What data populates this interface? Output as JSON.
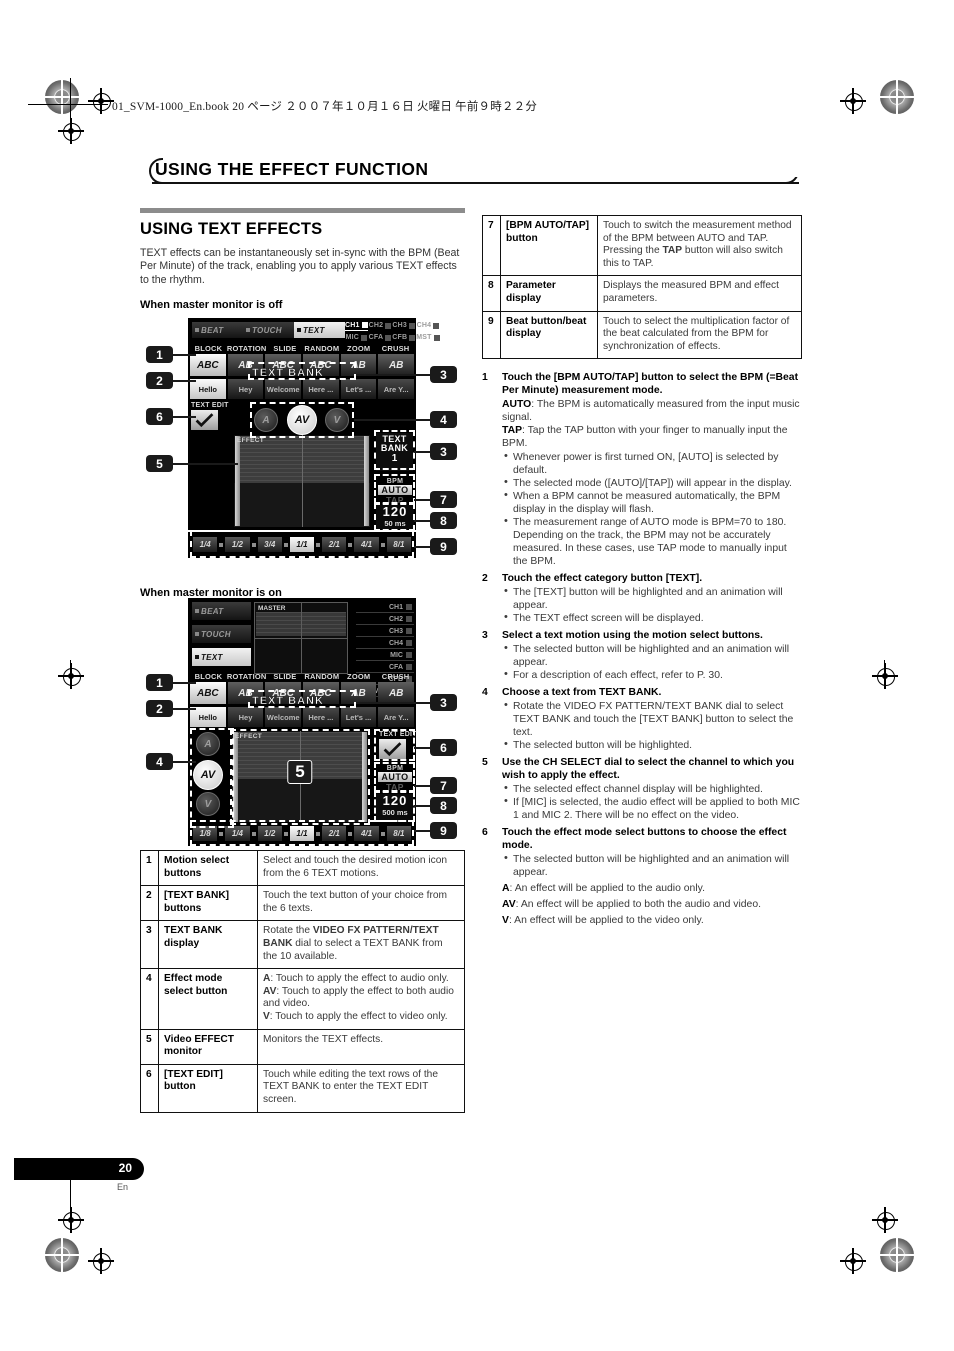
{
  "header": {
    "file_line": "01_SVM-1000_En.book  20 ページ  ２００７年１０月１６日  火曜日  午前９時２２分",
    "running_head": "USING THE EFFECT FUNCTION"
  },
  "left": {
    "section_title": "USING TEXT EFFECTS",
    "intro": "TEXT effects can be instantaneously set in-sync with the BPM (Beat Per Minute) of the track, enabling you to apply various TEXT effects to the rhythm.",
    "sub1": "When master monitor is off",
    "sub2": "When master monitor is on"
  },
  "device": {
    "fx_categories": [
      {
        "label": "BEAT",
        "active": false
      },
      {
        "label": "TOUCH",
        "active": false
      },
      {
        "label": "TEXT",
        "active": true
      }
    ],
    "channels_row1": [
      {
        "label": "CH1",
        "active": true
      },
      {
        "label": "CH2",
        "active": false
      },
      {
        "label": "CH3",
        "active": false
      },
      {
        "label": "CH4",
        "active": false
      }
    ],
    "channels_row2": [
      {
        "label": "MIC",
        "active": false
      },
      {
        "label": "CFA",
        "active": false
      },
      {
        "label": "CFB",
        "active": false
      },
      {
        "label": "MST",
        "active": false
      }
    ],
    "channels_column": [
      {
        "label": "CH1",
        "active": false
      },
      {
        "label": "CH2",
        "active": false
      },
      {
        "label": "CH3",
        "active": false
      },
      {
        "label": "CH4",
        "active": false
      },
      {
        "label": "MIC",
        "active": false
      },
      {
        "label": "CFA",
        "active": false
      },
      {
        "label": "CFB",
        "active": false
      },
      {
        "label": "MASTER",
        "active": false
      }
    ],
    "motion_labels": [
      "BLOCK",
      "ROTATION",
      "SLIDE",
      "RANDOM",
      "ZOOM",
      "CRUSH"
    ],
    "motion_glyphs": [
      "ABC",
      "AB",
      "ABC",
      "ABC",
      "AB",
      "AB"
    ],
    "text_bank_buttons": [
      {
        "label": "Hello",
        "active": true
      },
      {
        "label": "Hey",
        "active": false
      },
      {
        "label": "Welcome",
        "active": false
      },
      {
        "label": "Here ...",
        "active": false
      },
      {
        "label": "Let's ...",
        "active": false
      },
      {
        "label": "Are Y...",
        "active": false
      }
    ],
    "text_bank_overlay": "TEXT BANK",
    "text_edit_label": "TEXT EDIT",
    "effect_modes": [
      {
        "label": "A",
        "active": false
      },
      {
        "label": "AV",
        "active": true
      },
      {
        "label": "V",
        "active": false
      }
    ],
    "effect_monitor_label": "EFFECT",
    "master_monitor_label": "MASTER",
    "monitor_big_number": "5",
    "text_bank_display": {
      "line1": "TEXT",
      "line2": "BANK",
      "number": "1"
    },
    "bpm": {
      "caption": "BPM",
      "auto": "AUTO",
      "tap": "TAP"
    },
    "parameter": {
      "value": "120",
      "unit": "500 ms",
      "unit_off": "50 ms"
    },
    "beats_off": [
      {
        "label": "1/4",
        "active": false
      },
      {
        "label": "1/2",
        "active": false
      },
      {
        "label": "3/4",
        "active": false
      },
      {
        "label": "1/1",
        "active": true
      },
      {
        "label": "2/1",
        "active": false
      },
      {
        "label": "4/1",
        "active": false
      },
      {
        "label": "8/1",
        "active": false
      }
    ],
    "beats_on": [
      {
        "label": "1/8",
        "active": false
      },
      {
        "label": "1/4",
        "active": false
      },
      {
        "label": "1/2",
        "active": false
      },
      {
        "label": "1/1",
        "active": true
      },
      {
        "label": "2/1",
        "active": false
      },
      {
        "label": "4/1",
        "active": false
      },
      {
        "label": "8/1",
        "active": false
      }
    ],
    "callouts_diagram1": [
      "1",
      "2",
      "6",
      "5",
      "3",
      "4",
      "3",
      "7",
      "8",
      "9"
    ],
    "callouts_diagram2": [
      "1",
      "2",
      "4",
      "3",
      "6",
      "7",
      "8",
      "9"
    ]
  },
  "table_left": [
    {
      "n": "1",
      "term": "Motion select buttons",
      "desc": "Select and touch the desired motion icon from the 6 TEXT motions."
    },
    {
      "n": "2",
      "term": "[TEXT BANK] buttons",
      "desc": "Touch the text button of your choice from the 6 texts."
    },
    {
      "n": "3",
      "term": "TEXT BANK display",
      "desc_pre": "Rotate the ",
      "desc_b": "VIDEO FX PATTERN/TEXT BANK",
      "desc_post": " dial to select a TEXT BANK from the 10 available."
    },
    {
      "n": "4",
      "term": "Effect mode select button",
      "desc_lines": [
        {
          "b": "A",
          "t": ": Touch to apply the effect to audio only."
        },
        {
          "b": "AV",
          "t": ": Touch to apply the effect to both audio and video."
        },
        {
          "b": "V",
          "t": ": Touch to apply the effect to video only."
        }
      ]
    },
    {
      "n": "5",
      "term": "Video EFFECT monitor",
      "desc": "Monitors the TEXT effects."
    },
    {
      "n": "6",
      "term": "[TEXT EDIT] button",
      "desc": "Touch while editing the text rows of the TEXT BANK to enter the TEXT EDIT screen."
    }
  ],
  "table_right": [
    {
      "n": "7",
      "term": "[BPM AUTO/TAP] button",
      "desc_pre": "Touch to switch the measurement method of the BPM between AUTO and TAP. Pressing the ",
      "desc_b": "TAP",
      "desc_post": " button will also switch this to TAP."
    },
    {
      "n": "8",
      "term": "Parameter display",
      "desc": "Displays the measured BPM and effect parameters."
    },
    {
      "n": "9",
      "term": "Beat button/beat display",
      "desc": "Touch to select the multiplication factor of the beat calculated from the BPM for synchronization of effects."
    }
  ],
  "steps": [
    {
      "n": "1",
      "title": "Touch the [BPM AUTO/TAP] button to select the BPM (=Beat Per Minute) measurement mode.",
      "paras": [
        {
          "b": "AUTO",
          "t": ": The BPM is automatically measured from the input music signal."
        },
        {
          "b": "TAP",
          "t": ": Tap the TAP button with your finger to manually input the BPM."
        }
      ],
      "bullets": [
        "Whenever power is first turned ON, [AUTO] is selected by default.",
        "The selected mode ([AUTO]/[TAP]) will appear in the display.",
        "When a BPM cannot be measured automatically, the BPM display in the display will flash.",
        "The measurement range of AUTO mode is BPM=70 to 180. Depending on the track, the BPM may not be accurately measured. In these cases, use TAP mode to manually input the BPM."
      ]
    },
    {
      "n": "2",
      "title": "Touch the effect category button [TEXT].",
      "bullets": [
        "The [TEXT] button will be highlighted and an animation will appear.",
        "The TEXT effect screen will be displayed."
      ]
    },
    {
      "n": "3",
      "title": "Select a text motion using the motion select buttons.",
      "bullets": [
        "The selected button will be highlighted and an animation will appear.",
        "For a description of each effect, refer to P. 30."
      ]
    },
    {
      "n": "4",
      "title": "Choose a text from TEXT BANK.",
      "bullets": [
        "Rotate the VIDEO FX PATTERN/TEXT BANK dial to select TEXT BANK and touch the [TEXT BANK] button to select the text.",
        "The selected button will be highlighted."
      ]
    },
    {
      "n": "5",
      "title": "Use the CH SELECT dial to select the channel to which you wish to apply the effect.",
      "bullets": [
        "The selected effect channel display will be highlighted.",
        "If [MIC] is selected, the audio effect will be applied to both MIC 1 and MIC 2. There will be no effect on the video."
      ]
    },
    {
      "n": "6",
      "title": "Touch the effect mode select buttons to choose the effect mode.",
      "bullets": [
        "The selected button will be highlighted and an animation will appear."
      ],
      "paras_after": [
        {
          "b": "A",
          "t": ": An effect will be applied to the audio only."
        },
        {
          "b": "AV",
          "t": ": An effect will be applied to both the audio and video."
        },
        {
          "b": "V",
          "t": ": An effect will be applied to the video only."
        }
      ]
    }
  ],
  "footer": {
    "page_number": "20",
    "lang": "En"
  }
}
